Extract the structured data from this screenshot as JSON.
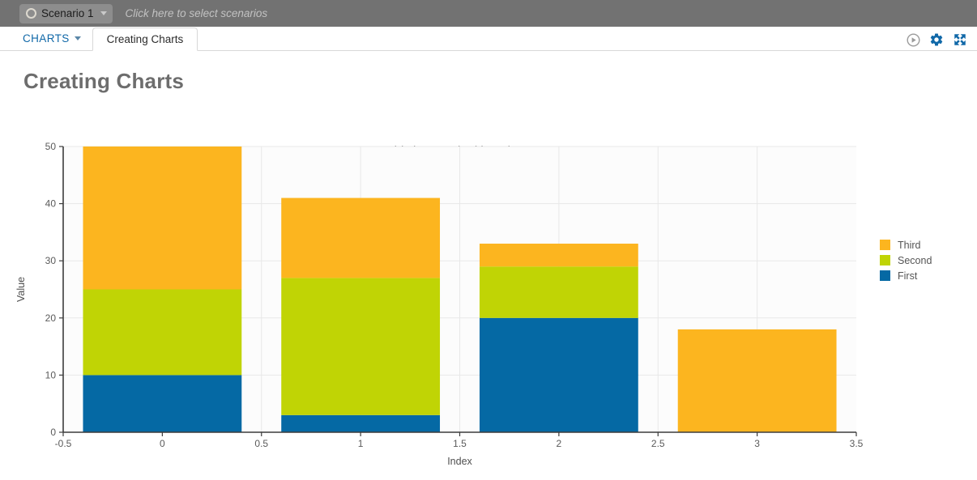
{
  "scenario_bar": {
    "scenario_label": "Scenario 1",
    "hint_text": "Click here to select scenarios",
    "circle_icon": "radio-circle-icon",
    "caret_icon": "chevron-down-icon"
  },
  "tab_bar": {
    "menu_label": "CHARTS",
    "menu_caret_icon": "chevron-down-icon",
    "active_tab_label": "Creating Charts",
    "actions": [
      {
        "name": "run-button",
        "icon": "play-circle-icon",
        "color": "#9b9b9b"
      },
      {
        "name": "settings-button",
        "icon": "gear-icon",
        "color": "#1068a8"
      },
      {
        "name": "fullscreen-button",
        "icon": "expand-icon",
        "color": "#1068a8"
      }
    ]
  },
  "page": {
    "title": "Creating Charts"
  },
  "chart_data": {
    "type": "bar",
    "stacked": true,
    "title": "This is a stacked bar chart",
    "xlabel": "Index",
    "ylabel": "Value",
    "x": [
      0,
      1,
      2,
      3
    ],
    "categories": [
      "0",
      "1",
      "2",
      "3"
    ],
    "series": [
      {
        "name": "First",
        "color": "#0569a4",
        "values": [
          10,
          3,
          20,
          0
        ]
      },
      {
        "name": "Second",
        "color": "#c0d405",
        "values": [
          15,
          24,
          9,
          0
        ]
      },
      {
        "name": "Third",
        "color": "#fcb51f",
        "values": [
          25,
          14,
          4,
          18
        ]
      }
    ],
    "totals": [
      50,
      41,
      33,
      18
    ],
    "legend_order": [
      "Third",
      "Second",
      "First"
    ],
    "legend_position": "right",
    "bar_width": 0.8,
    "xlim": [
      -0.5,
      3.5
    ],
    "ylim": [
      0,
      50
    ],
    "xticks": [
      "-0.5",
      "0",
      "0.5",
      "1",
      "1.5",
      "2",
      "2.5",
      "3",
      "3.5"
    ],
    "xtick_values": [
      -0.5,
      0,
      0.5,
      1,
      1.5,
      2,
      2.5,
      3,
      3.5
    ],
    "yticks": [
      "0",
      "10",
      "20",
      "30",
      "40",
      "50"
    ],
    "ytick_values": [
      0,
      10,
      20,
      30,
      40,
      50
    ],
    "grid": true,
    "plot_bg": "#fcfcfc",
    "grid_color": "#e8e8e8"
  }
}
